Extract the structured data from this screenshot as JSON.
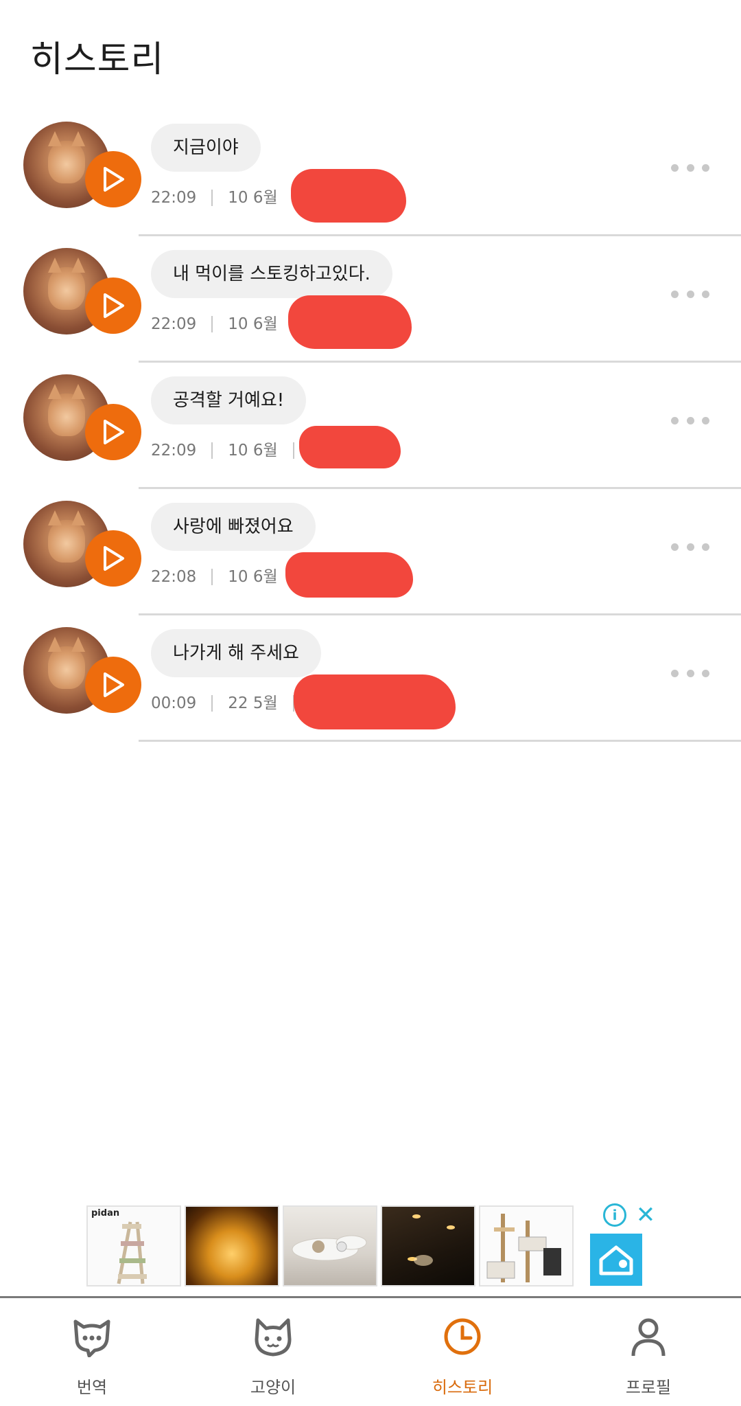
{
  "header": {
    "title": "히스토리"
  },
  "history": [
    {
      "message": "지금이야",
      "time": "22:09",
      "date": "10 6월"
    },
    {
      "message": "내 먹이를 스토킹하고있다.",
      "time": "22:09",
      "date": "10 6월"
    },
    {
      "message": "공격할 거예요!",
      "time": "22:09",
      "date": "10 6월"
    },
    {
      "message": "사랑에 빠졌어요",
      "time": "22:08",
      "date": "10 6월"
    },
    {
      "message": "나가게 해 주세요",
      "time": "00:09",
      "date": "22 5월"
    }
  ],
  "ad": {
    "brand": "pidan",
    "info_icon": "info-icon",
    "close_icon": "close-icon"
  },
  "nav": {
    "items": [
      {
        "label": "번역",
        "icon": "chat-cat-icon"
      },
      {
        "label": "고양이",
        "icon": "cat-icon"
      },
      {
        "label": "히스토리",
        "icon": "clock-icon"
      },
      {
        "label": "프로필",
        "icon": "person-icon"
      }
    ],
    "active_index": 2
  },
  "colors": {
    "accent": "#ee6c0d",
    "active_label": "#d96a0b",
    "bubble": "#f0f0f0",
    "redaction": "#f2473d"
  }
}
